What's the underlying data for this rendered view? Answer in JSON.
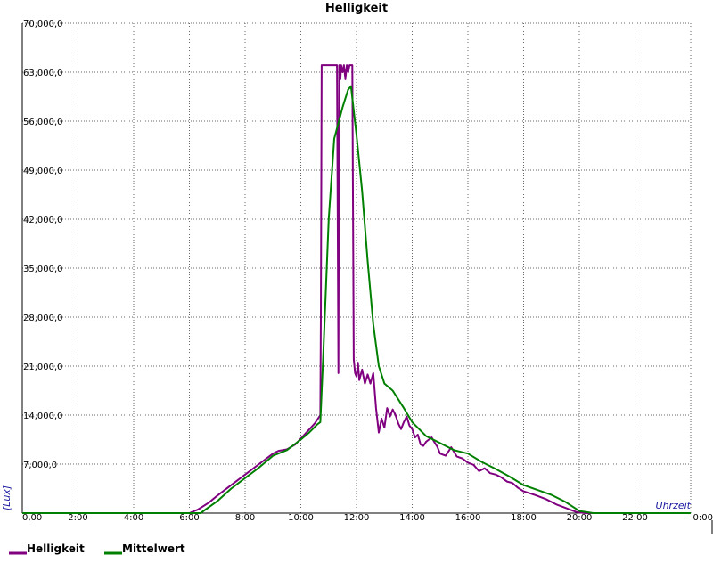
{
  "chart_data": {
    "type": "line",
    "title": "Helligkeit",
    "xlabel": "Uhrzeit",
    "ylabel": "[Lux]",
    "x_unit": "hours",
    "xlim": [
      0,
      24
    ],
    "ylim": [
      0,
      70000
    ],
    "x_ticks": [
      0,
      2,
      4,
      6,
      8,
      10,
      12,
      14,
      16,
      18,
      20,
      22,
      24
    ],
    "x_tick_labels": [
      "0,00",
      "2:00",
      "4:00",
      "6:00",
      "8:00",
      "10:00",
      "12:00",
      "14:00",
      "16:00",
      "18:00",
      "20:00",
      "22:00",
      "0:00"
    ],
    "y_ticks": [
      7000,
      14000,
      21000,
      28000,
      35000,
      42000,
      49000,
      56000,
      63000,
      70000
    ],
    "y_tick_labels": [
      "7,000,0",
      "14,000,0",
      "21,000,0",
      "28,000,0",
      "35,000,0",
      "42,000,0",
      "49,000,0",
      "56,000,0",
      "63,000,0",
      "70,000,0"
    ],
    "grid": true,
    "legend_position": "bottom-left",
    "series": [
      {
        "name": "Helligkeit",
        "color": "#800080",
        "x": [
          0,
          6.0,
          6.3,
          6.7,
          7.0,
          7.5,
          8.0,
          8.5,
          9.0,
          9.2,
          9.5,
          9.8,
          10.2,
          10.5,
          10.7,
          10.72,
          10.75,
          11.3,
          11.35,
          11.38,
          11.42,
          11.45,
          11.5,
          11.55,
          11.6,
          11.65,
          11.7,
          11.75,
          11.85,
          11.9,
          11.95,
          12.0,
          12.05,
          12.1,
          12.2,
          12.3,
          12.4,
          12.5,
          12.6,
          12.7,
          12.8,
          12.9,
          13.0,
          13.1,
          13.2,
          13.3,
          13.4,
          13.5,
          13.6,
          13.7,
          13.8,
          13.9,
          14.0,
          14.1,
          14.2,
          14.3,
          14.4,
          14.5,
          14.6,
          14.7,
          14.8,
          14.9,
          15.0,
          15.2,
          15.4,
          15.6,
          15.8,
          16.0,
          16.2,
          16.4,
          16.6,
          16.8,
          17.0,
          17.2,
          17.4,
          17.6,
          17.8,
          18.0,
          18.4,
          18.8,
          19.2,
          19.6,
          19.9,
          20.2,
          21.0,
          24.0
        ],
        "values": [
          0,
          0,
          500,
          1500,
          2500,
          4000,
          5500,
          7000,
          8500,
          8900,
          9100,
          9800,
          11500,
          12800,
          14000,
          28000,
          64000,
          64000,
          20000,
          64000,
          62000,
          64000,
          63000,
          64000,
          62000,
          64000,
          63000,
          64000,
          64000,
          22000,
          20000,
          19500,
          21500,
          19000,
          20500,
          18500,
          19800,
          18500,
          20000,
          15000,
          11500,
          13500,
          12200,
          15000,
          13800,
          14800,
          14000,
          12800,
          12000,
          13000,
          13800,
          12500,
          12000,
          10800,
          11200,
          9800,
          9600,
          10200,
          10500,
          10800,
          10100,
          9500,
          8500,
          8200,
          9400,
          8100,
          7800,
          7200,
          6900,
          6000,
          6400,
          5700,
          5500,
          5100,
          4500,
          4300,
          3600,
          3100,
          2600,
          2000,
          1200,
          600,
          150,
          0,
          0,
          0
        ]
      },
      {
        "name": "Mittelwert",
        "color": "#008000",
        "x": [
          0,
          6.4,
          7.0,
          7.5,
          8.0,
          8.5,
          9.0,
          9.5,
          10.0,
          10.3,
          10.6,
          10.7,
          10.8,
          11.0,
          11.2,
          11.5,
          11.7,
          11.8,
          12.0,
          12.2,
          12.4,
          12.6,
          12.8,
          13.0,
          13.3,
          13.7,
          14.0,
          14.5,
          15.0,
          15.5,
          16.0,
          16.5,
          17.0,
          17.5,
          18.0,
          18.5,
          19.0,
          19.5,
          20.0,
          20.5,
          24.0
        ],
        "values": [
          0,
          0,
          1700,
          3500,
          5000,
          6500,
          8200,
          9000,
          10500,
          11500,
          12700,
          13000,
          22000,
          42000,
          53500,
          58000,
          60500,
          61000,
          54000,
          46000,
          36000,
          27000,
          21000,
          18500,
          17500,
          15000,
          13000,
          11000,
          10000,
          9000,
          8500,
          7300,
          6300,
          5200,
          4000,
          3300,
          2600,
          1600,
          300,
          0,
          0
        ]
      }
    ]
  }
}
